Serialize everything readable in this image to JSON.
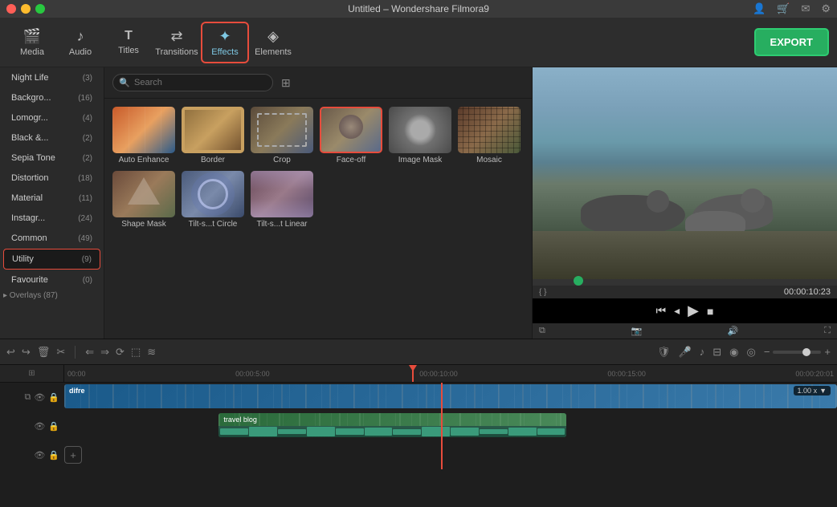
{
  "app": {
    "title": "Untitled – Wondershare Filmora9"
  },
  "toolbar": {
    "items": [
      {
        "id": "media",
        "label": "Media",
        "icon": "🎬"
      },
      {
        "id": "audio",
        "label": "Audio",
        "icon": "🎵"
      },
      {
        "id": "titles",
        "label": "Titles",
        "icon": "T"
      },
      {
        "id": "transitions",
        "label": "Transitions",
        "icon": "⇄"
      },
      {
        "id": "effects",
        "label": "Effects",
        "icon": "✦",
        "active": true
      },
      {
        "id": "elements",
        "label": "Elements",
        "icon": "◈"
      }
    ],
    "export_label": "EXPORT"
  },
  "sidebar": {
    "items": [
      {
        "label": "Night Life",
        "count": "(3)"
      },
      {
        "label": "Backgro...",
        "count": "(16)"
      },
      {
        "label": "Lomogr...",
        "count": "(4)"
      },
      {
        "label": "Black &...",
        "count": "(2)"
      },
      {
        "label": "Sepia Tone",
        "count": "(2)"
      },
      {
        "label": "Distortion",
        "count": "(18)"
      },
      {
        "label": "Material",
        "count": "(11)"
      },
      {
        "label": "Instagr...",
        "count": "(24)"
      },
      {
        "label": "Common",
        "count": "(49)"
      },
      {
        "label": "Utility",
        "count": "(9)",
        "active": true
      },
      {
        "label": "Favourite",
        "count": "(0)"
      },
      {
        "label": "Overlays",
        "count": "(87)"
      }
    ],
    "collapse_label": "▸ Overlays"
  },
  "search": {
    "placeholder": "Search"
  },
  "effects": {
    "items": [
      {
        "id": "auto-enhance",
        "label": "Auto Enhance",
        "thumb": "auto-enhance"
      },
      {
        "id": "border",
        "label": "Border",
        "thumb": "border"
      },
      {
        "id": "crop",
        "label": "Crop",
        "thumb": "crop"
      },
      {
        "id": "face-off",
        "label": "Face-off",
        "thumb": "face-off",
        "selected": true
      },
      {
        "id": "image-mask",
        "label": "Image Mask",
        "thumb": "image-mask"
      },
      {
        "id": "mosaic",
        "label": "Mosaic",
        "thumb": "mosaic"
      },
      {
        "id": "shape-mask",
        "label": "Shape Mask",
        "thumb": "shape-mask"
      },
      {
        "id": "tilt-circle",
        "label": "Tilt-s...t Circle",
        "thumb": "tilt-circle"
      },
      {
        "id": "tilt-linear",
        "label": "Tilt-s...t Linear",
        "thumb": "tilt-linear"
      }
    ]
  },
  "preview": {
    "time": "00:00:10:23",
    "progress_pct": 15
  },
  "timeline": {
    "toolbar_buttons": [
      "undo",
      "redo",
      "delete",
      "cut",
      "undo2",
      "redo2",
      "speed",
      "audio",
      "zoom"
    ],
    "ruler_marks": [
      "00:00",
      "00:00:5:00",
      "00:00:10:00",
      "00:00:15:00",
      "00:00:20:01"
    ],
    "tracks": [
      {
        "id": "video1",
        "label": "difre",
        "type": "video",
        "speed": "1.00 x"
      },
      {
        "id": "video2",
        "label": "travel blog",
        "type": "video"
      },
      {
        "id": "audio1",
        "label": "",
        "type": "audio"
      }
    ],
    "zoom_label": "+",
    "add_track_label": "+"
  }
}
